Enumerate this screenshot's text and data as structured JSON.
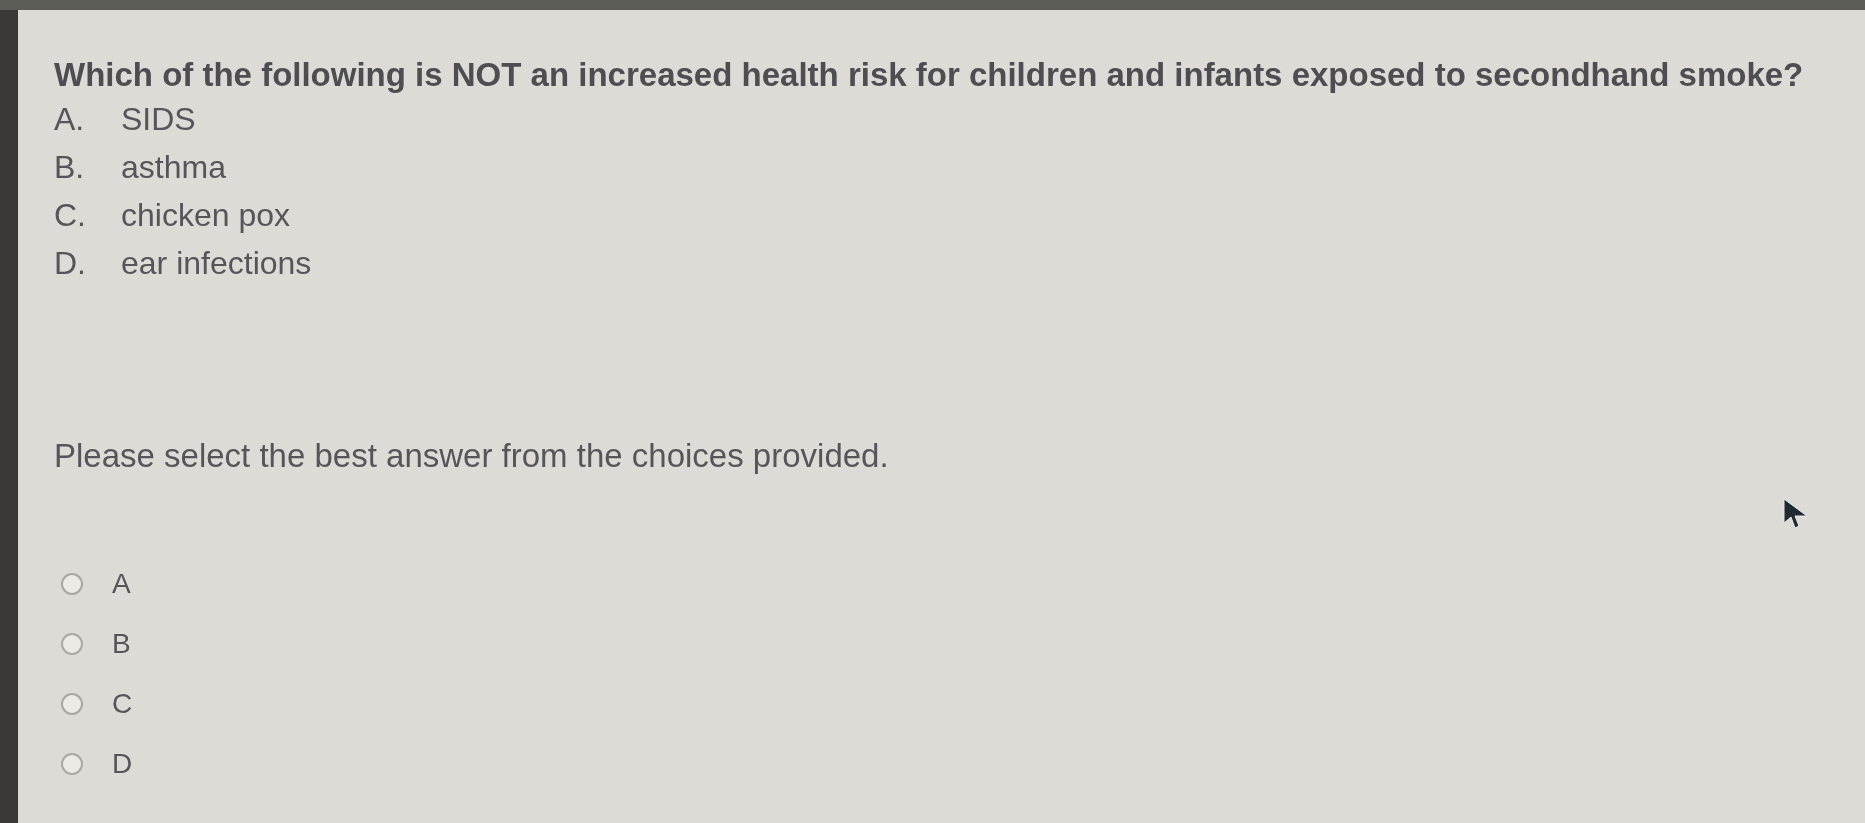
{
  "question": "Which of the following is NOT an increased health risk for children and infants exposed to secondhand smoke?",
  "options": [
    {
      "letter": "A.",
      "text": "SIDS"
    },
    {
      "letter": "B.",
      "text": "asthma"
    },
    {
      "letter": "C.",
      "text": "chicken pox"
    },
    {
      "letter": "D.",
      "text": "ear infections"
    }
  ],
  "instruction": "Please select the best answer from the choices provided.",
  "choices": [
    {
      "label": "A",
      "selected": false
    },
    {
      "label": "B",
      "selected": false
    },
    {
      "label": "C",
      "selected": false
    },
    {
      "label": "D",
      "selected": false
    }
  ]
}
